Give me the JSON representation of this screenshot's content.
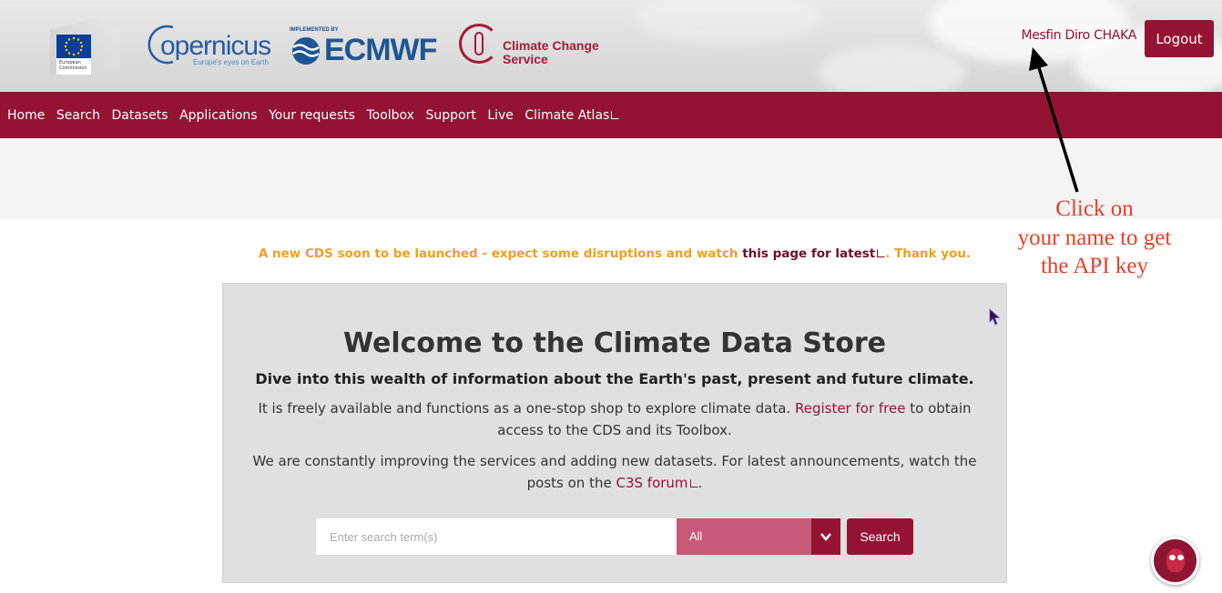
{
  "header": {
    "eu_caption": "European Commission",
    "copernicus_word": "opernicus",
    "copernicus_tagline": "Europe's eyes on Earth",
    "ecmwf_implemented": "IMPLEMENTED BY",
    "ecmwf_word": "ECMWF",
    "c3s_line1": "Climate Change",
    "c3s_line2": "Service",
    "username": "Mesfin Diro CHAKA",
    "logout_label": "Logout"
  },
  "nav": {
    "items": [
      {
        "label": "Home"
      },
      {
        "label": "Search"
      },
      {
        "label": "Datasets"
      },
      {
        "label": "Applications"
      },
      {
        "label": "Your requests"
      },
      {
        "label": "Toolbox"
      },
      {
        "label": "Support"
      },
      {
        "label": "Live"
      },
      {
        "label": "Climate Atlas",
        "external": true
      }
    ]
  },
  "notice": {
    "before": "A new CDS soon to be launched - expect some disruptions and watch ",
    "link": "this page for latest",
    "after": ". Thank you."
  },
  "annotation": {
    "line1": "Click on",
    "line2": "your name to get",
    "line3": "the API key",
    "color": "#e93e28"
  },
  "welcome": {
    "title": "Welcome to the Climate Data Store",
    "subtitle": "Dive into this wealth of information about the Earth's past, present and future climate.",
    "p1_before": "It is freely available and functions as a one-stop shop to explore climate data. ",
    "p1_link": "Register for free",
    "p1_after": " to obtain access to the CDS and its Toolbox.",
    "p2_before": "We are constantly improving the services and adding new datasets. For latest announcements, watch the posts on the ",
    "p2_link": "C3S forum",
    "p2_after": "."
  },
  "search": {
    "placeholder": "Enter search term(s)",
    "category": "All",
    "button_label": "Search"
  },
  "colors": {
    "brand": "#941333",
    "notice": "#f1a01a"
  }
}
